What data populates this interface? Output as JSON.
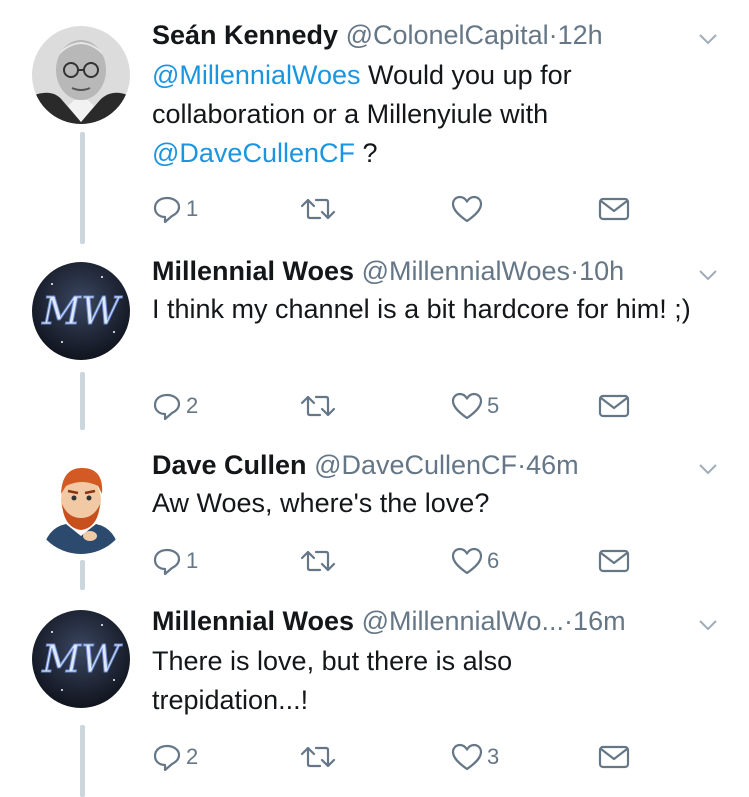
{
  "tweets": [
    {
      "name": "Seán Kennedy",
      "handle": "@ColonelCapital",
      "dot": "·",
      "time": "12h",
      "mention1": "@MillennialWoes",
      "text1": " Would you up for collaboration or a Millenyiule with ",
      "mention2": "@DaveCullenCF",
      "text2": " ?",
      "reply_count": "1",
      "retweet_count": "",
      "like_count": "",
      "avatar": "elderly-man-bw-photo"
    },
    {
      "name": "Millennial Woes",
      "handle": "@MillennialWoes",
      "dot": "·",
      "time": "10h",
      "text": "I think my channel is a bit hardcore for him! ;)",
      "reply_count": "2",
      "retweet_count": "",
      "like_count": "5",
      "avatar_text": "MW"
    },
    {
      "name": "Dave Cullen",
      "handle": "@DaveCullenCF",
      "dot": "·",
      "time": "46m",
      "text": "Aw Woes, where's the love?",
      "reply_count": "1",
      "retweet_count": "",
      "like_count": "6",
      "avatar": "cartoon-red-hair-beard"
    },
    {
      "name": "Millennial Woes",
      "handle": "@MillennialWo...",
      "dot": "·",
      "time": "16m",
      "text": "There is love, but there is also trepidation...!",
      "reply_count": "2",
      "retweet_count": "",
      "like_count": "3",
      "avatar_text": "MW"
    }
  ],
  "colors": {
    "text": "#14171a",
    "secondary": "#657786",
    "link": "#1b95e0",
    "thread_line": "#ccd6dd"
  }
}
